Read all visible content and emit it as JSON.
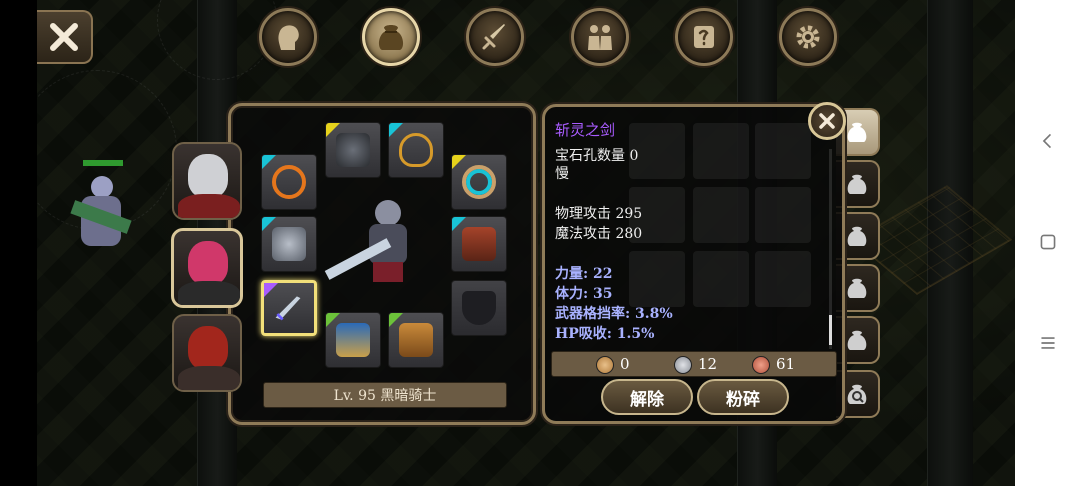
{
  "top_tabs": [
    {
      "name": "character",
      "icon": "head-silhouette-icon"
    },
    {
      "name": "inventory",
      "icon": "bag-icon",
      "active": true
    },
    {
      "name": "skills",
      "icon": "sword-icon"
    },
    {
      "name": "party",
      "icon": "people-icon"
    },
    {
      "name": "quests",
      "icon": "scroll-icon"
    },
    {
      "name": "settings",
      "icon": "gear-icon"
    }
  ],
  "equipment": {
    "level_label": "Lv. 95 黑暗骑士"
  },
  "item_detail": {
    "name": "斩灵之剑",
    "name_color": "#a95cff",
    "gem_slots": "宝石孔数量 0",
    "speed": "慢",
    "phys_attack": "物理攻击 295",
    "magic_attack": "魔法攻击 280",
    "bonuses": [
      "力量: 22",
      "体力: 35",
      "武器格挡率: 3.8%",
      "HP吸收: 1.5%"
    ],
    "currency": {
      "gold": "0",
      "silver": "12",
      "copper": "61"
    },
    "unequip_label": "解除",
    "shatter_label": "粉碎"
  },
  "colors": {
    "frame": "#8f7b58",
    "bonus_text": "#a9b2ff",
    "purple_rarity": "#a95cff",
    "cyan_rarity": "#19c3d6",
    "yellow_rarity": "#e6d21c",
    "green_rarity": "#6cc23a"
  }
}
